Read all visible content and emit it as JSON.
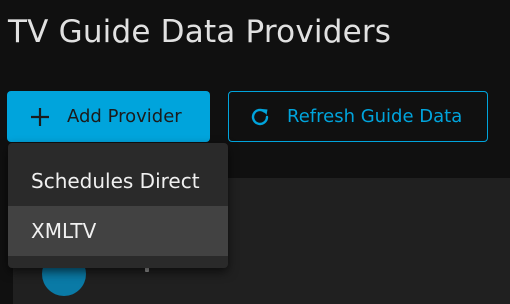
{
  "page": {
    "title": "TV Guide Data Providers"
  },
  "toolbar": {
    "add_provider_label": "Add Provider",
    "refresh_label": "Refresh Guide Data",
    "add_icon": "plus-icon",
    "refresh_icon": "refresh-icon"
  },
  "dropdown": {
    "items": [
      {
        "label": "Schedules Direct"
      },
      {
        "label": "XMLTV"
      }
    ],
    "highlighted_item": "XMLTV"
  },
  "colors": {
    "accent": "#00a4dc",
    "background": "#101010",
    "menu_background": "#2a2a2a",
    "menu_hover": "#424242"
  }
}
